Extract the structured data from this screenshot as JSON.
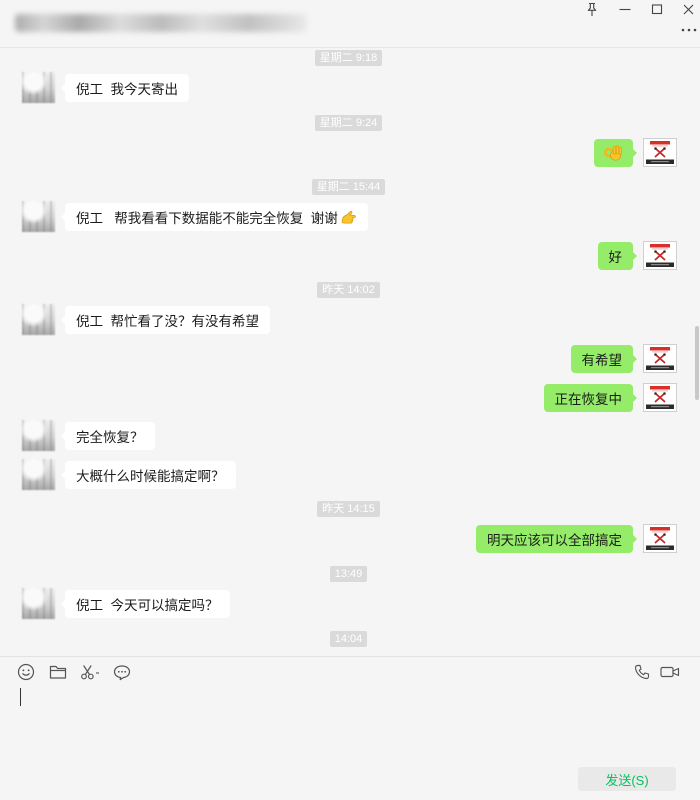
{
  "window": {
    "pin_icon": "pin-icon",
    "minimize_icon": "minimize-icon",
    "maximize_icon": "maximize-icon",
    "close_icon": "close-icon",
    "more_icon": "more-icon"
  },
  "chat": [
    {
      "time": "星期二 9:18"
    },
    {
      "text": "倪工  我今天寄出"
    },
    {
      "time": "星期二 9:24"
    },
    {
      "emoji": "ok-hand-emoji"
    },
    {
      "time": "星期二 15:44"
    },
    {
      "text": "倪工   帮我看看下数据能不能完全恢复  谢谢",
      "emoji": "hand-emoji"
    },
    {
      "text": "好"
    },
    {
      "time": "昨天 14:02"
    },
    {
      "text": "倪工  帮忙看了没？有没有希望"
    },
    {
      "text": "有希望"
    },
    {
      "text": "正在恢复中"
    },
    {
      "text": "完全恢复？"
    },
    {
      "text": "大概什么时候能搞定啊？"
    },
    {
      "time": "昨天 14:15"
    },
    {
      "text": "明天应该可以全部搞定"
    },
    {
      "time": "13:49"
    },
    {
      "text": "倪工  今天可以搞定吗？"
    },
    {
      "time": "14:04"
    }
  ],
  "toolbar": {
    "emoji_icon": "smiley-icon",
    "file_icon": "folder-icon",
    "screenshot_icon": "scissors-icon",
    "history_icon": "chat-bubble-icon",
    "voice_call_icon": "phone-icon",
    "video_call_icon": "video-camera-icon"
  },
  "composer": {
    "value": "",
    "send_label": "发送(S)"
  },
  "colors": {
    "background": "#f5f5f5",
    "bubble_self": "#95ec69",
    "bubble_contact": "#ffffff",
    "timestamp_bg": "#dadada",
    "send_text": "#07c160"
  }
}
